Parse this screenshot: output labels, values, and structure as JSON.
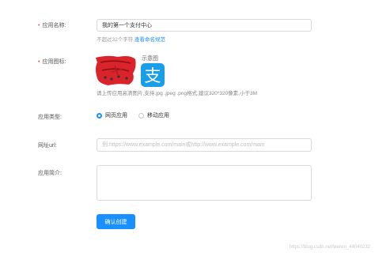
{
  "form": {
    "app_name": {
      "label": "应用名称:",
      "value": "我的第一个支付中心",
      "hint": "不超过32个字符,",
      "hint_link": "查看命名规范"
    },
    "app_icon": {
      "label": "应用图标:",
      "sample_label": "示意图",
      "hint": "请上传应用高清图片,支持.jpg .jpeg .png格式,建议320*320像素,小于3M",
      "sample_icon": "alipay-icon",
      "sample_color": "#1a9ee8",
      "uploaded_color": "#d9242b"
    },
    "app_type": {
      "label": "应用类型:",
      "options": [
        {
          "label": "网页应用",
          "selected": true
        },
        {
          "label": "移动应用",
          "selected": false
        }
      ]
    },
    "url": {
      "label": "网址url:",
      "placeholder": "例:https://www.example.com/main或http://www.example.com/main"
    },
    "intro": {
      "label": "应用简介:",
      "value": ""
    },
    "submit_label": "确认创建"
  },
  "watermark": "https://blog.csdn.net/weixin_44040232",
  "accent_color": "#1890ff"
}
